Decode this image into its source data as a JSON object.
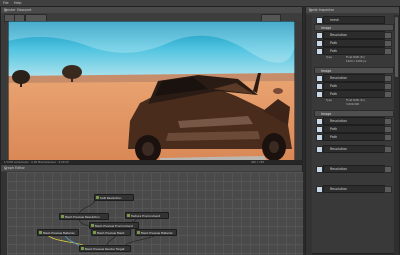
{
  "menu": {
    "items": [
      "File",
      "Help"
    ]
  },
  "viewport": {
    "title": "Render Viewport",
    "status": "1/1000 samples/px · 0.06 Msamples/sec · 0:00:00",
    "status_right": "460 x 258"
  },
  "graph": {
    "title": "Graph Editor",
    "nodes": [
      "SAD Resolution",
      "Mesh Preview Resolution",
      "Texture Environment",
      "Mesh Preview Environment",
      "Mesh Preview Material",
      "Mesh Preview Mesh",
      "Mesh Preview Material",
      "Mesh Preview Render Target"
    ]
  },
  "inspector": {
    "title": "Node Inspector",
    "top_label": "mesh",
    "sections": [
      {
        "label": "image",
        "rows": [
          "Resolution",
          "Path",
          "Path"
        ]
      },
      {
        "label": "Image",
        "rows": [
          "Resolution",
          "Path",
          "Path"
        ]
      },
      {
        "label": "Image",
        "rows": [
          "Resolution",
          "Path",
          "Path",
          "Resolution",
          "Resolution",
          "Resolution"
        ]
      }
    ],
    "kv1": [
      "Type",
      "Float RGB (3x)",
      "1920 x 1080 px"
    ],
    "kv2": [
      "Type",
      "Float RGB (3x)",
      "3,600,000"
    ]
  }
}
